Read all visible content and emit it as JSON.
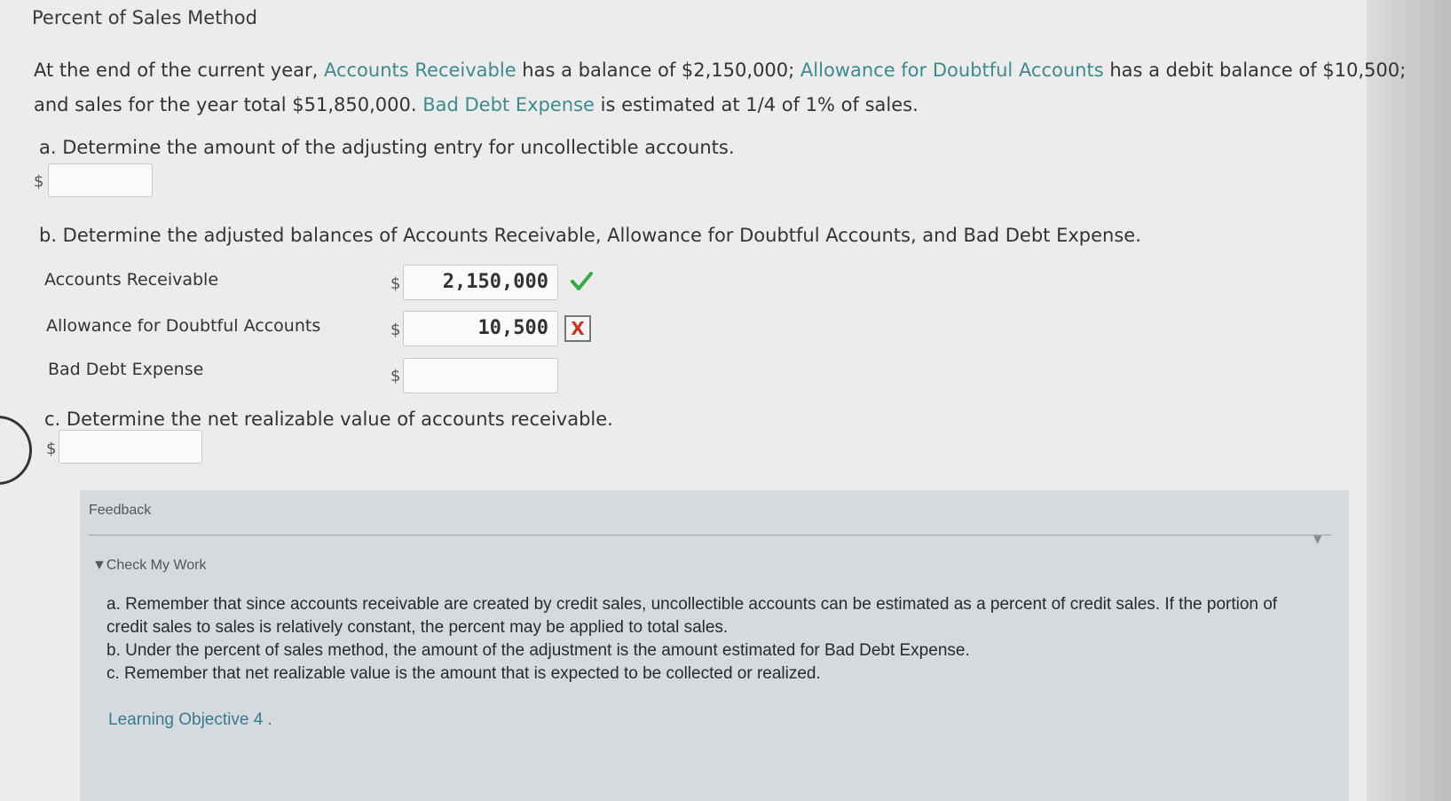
{
  "page": {
    "title": "Percent of Sales Method"
  },
  "intro": {
    "part1": "At the end of the current year, ",
    "term1": "Accounts Receivable",
    "part2": " has a balance of $2,150,000; ",
    "term2": "Allowance for Doubtful Accounts",
    "part3": " has a debit balance of $10,500; and sales for the year total $51,850,000. ",
    "term3": "Bad Debt Expense",
    "part4": " is estimated at 1/4 of 1% of sales."
  },
  "question_a": {
    "label": "a. Determine the amount of the adjusting entry for uncollectible accounts.",
    "currency": "$",
    "value": ""
  },
  "question_b": {
    "label": "b. Determine the adjusted balances of Accounts Receivable, Allowance for Doubtful Accounts, and Bad Debt Expense.",
    "rows": [
      {
        "label": "Accounts Receivable",
        "currency": "$",
        "value": "2,150,000",
        "status": "correct"
      },
      {
        "label": "Allowance for Doubtful Accounts",
        "currency": "$",
        "value": "10,500",
        "status": "incorrect"
      },
      {
        "label": "Bad Debt Expense",
        "currency": "$",
        "value": "",
        "status": ""
      }
    ],
    "incorrect_mark": "X"
  },
  "question_c": {
    "label": "c. Determine the net realizable value of accounts receivable.",
    "currency": "$",
    "value": ""
  },
  "feedback": {
    "title": "Feedback",
    "collapse_icon": "▼",
    "check_my_work": "▼Check My Work",
    "hints": [
      "a. Remember that since accounts receivable are created by credit sales, uncollectible accounts can be estimated as a percent of credit sales. If the portion of credit sales to sales is relatively constant, the percent may be applied to total sales.",
      "b. Under the percent of sales method, the amount of the adjustment is the amount estimated for Bad Debt Expense.",
      "c. Remember that net realizable value is the amount that is expected to be collected or realized."
    ],
    "learning_objective": "Learning Objective 4 ."
  },
  "colors": {
    "term": "#3f8a8c",
    "correct": "#3aa843",
    "incorrect": "#c0392b",
    "feedback_bg": "#d4dadd"
  }
}
